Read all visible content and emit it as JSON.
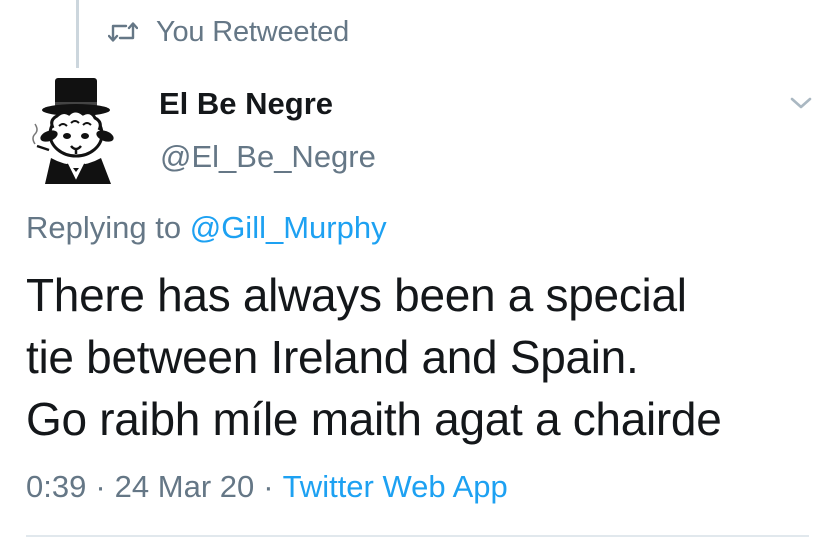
{
  "retweet": {
    "icon": "retweet-icon",
    "text": "You Retweeted"
  },
  "author": {
    "avatar_icon": "top-hat-sheep-avatar",
    "name": "El Be Negre",
    "handle": "@El_Be_Negre"
  },
  "reply": {
    "prefix": "Replying to",
    "mention": "@Gill_Murphy"
  },
  "tweet": {
    "lines": [
      "There has always been a special",
      "tie between Ireland and Spain.",
      "Go raibh míle maith agat a chairde"
    ]
  },
  "meta": {
    "time": "0:39",
    "separator": "·",
    "date": "24 Mar 20",
    "source": "Twitter Web App"
  },
  "colors": {
    "text": "#14171a",
    "secondary": "#657786",
    "link": "#1da1f2",
    "divider": "#e1e8ed"
  }
}
